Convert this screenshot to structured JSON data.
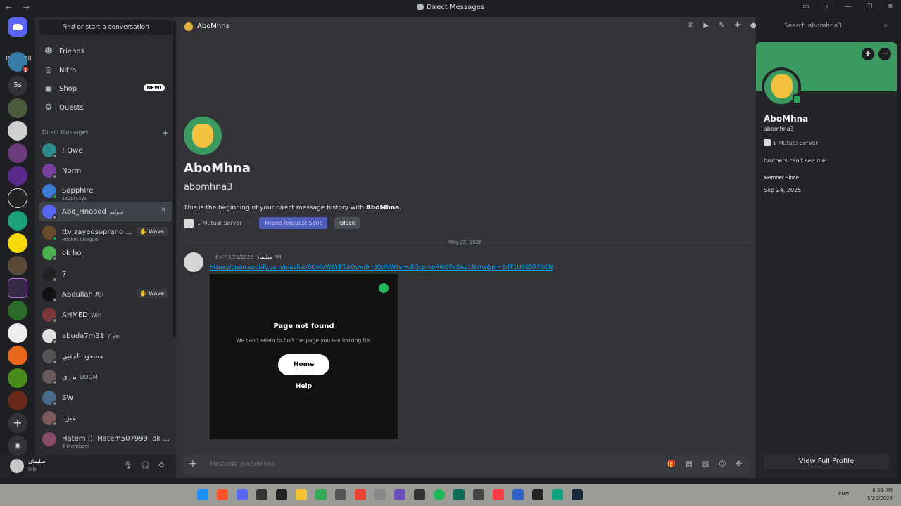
{
  "titlebar": {
    "title": "Direct Messages",
    "nav": "← →"
  },
  "servers": {
    "read_all": "Read All",
    "text_server": "Ss",
    "badge": "1"
  },
  "sidebar": {
    "find_placeholder": "Find or start a conversation",
    "nav": [
      {
        "label": "Friends",
        "icon": "friends-icon"
      },
      {
        "label": "Nitro",
        "icon": "nitro-icon"
      },
      {
        "label": "Shop",
        "icon": "shop-icon",
        "badge": "NEW!"
      },
      {
        "label": "Quests",
        "icon": "quests-icon"
      }
    ],
    "dm_header": "Direct Messages",
    "dms": [
      {
        "name": "! Qwe",
        "color": "#2e8b8b"
      },
      {
        "name": "Norm",
        "color": "#7b3fa0"
      },
      {
        "name": "Sapphire",
        "sub": "sapph.xyz",
        "color": "#3b7bd4"
      },
      {
        "name": "Abo_Hnoood",
        "color": "#5865f2",
        "tag": "سوليم",
        "active": true
      },
      {
        "name": "ttv zayedsoprano ...",
        "sub": "Rocket League",
        "color": "#6b4a2a",
        "wave": "Wave"
      },
      {
        "name": "ok ho",
        "color": "#4caf50"
      },
      {
        "name": "7",
        "color": "#222222"
      },
      {
        "name": "Abdullah Ali",
        "color": "#111111",
        "wave": "Wave"
      },
      {
        "name": "AHMED",
        "color": "#7a3a3a",
        "tag": "Win"
      },
      {
        "name": "abuda7m31",
        "color": "#e0e0e0",
        "tag": "Y ye"
      },
      {
        "name": "مسعود الجنبي",
        "color": "#555555"
      },
      {
        "name": "يزري",
        "color": "#6a5a5a",
        "tag": "DOOM"
      },
      {
        "name": "SW",
        "color": "#4a6a8a"
      },
      {
        "name": "عبرنا",
        "color": "#7a5a5a"
      },
      {
        "name": "Hatem :), Hatem507999, ok ...",
        "sub": "4 Members",
        "color": "#8a4a6a"
      }
    ],
    "wave_label": "Wave"
  },
  "user": {
    "name": "سليمان",
    "status": "Idle"
  },
  "channel": {
    "name": "AboMhna",
    "search_placeholder": "Search abomhna3"
  },
  "intro": {
    "name": "AboMhna",
    "username": "abomhna3",
    "desc_prefix": "This is the beginning of your direct message history with ",
    "desc_name": "AboMhna",
    "desc_suffix": ".",
    "mutual": "1 Mutual Server",
    "friend_request": "Friend Request Sent",
    "block": "Block"
  },
  "messages": {
    "date_divider": "May 25, 2026",
    "author": "سليمان",
    "time": "5/25/2026 6:47 PM",
    "link": "https://open.spotify.com/playlist/6QMVWSYETstOywj9mJQdNW?si=dlOcp-kpR6i67xSAa1Nktw&pi=1dT1U6S5RF2CN",
    "embed": {
      "title": "Page not found",
      "subtitle": "We can't seem to find the page you are looking for.",
      "home": "Home",
      "help": "Help"
    }
  },
  "composer": {
    "placeholder": "Message @AboMhna"
  },
  "profile": {
    "name": "AboMhna",
    "username": "abomhna3",
    "mutual": "1 Mutual Server",
    "bio": "brothers can't see me",
    "member_since_label": "Member Since",
    "member_since": "Sep 24, 2025",
    "view_full": "View Full Profile"
  },
  "taskbar": {
    "lang": "ENG",
    "time": "6:28 AM",
    "date": "5/28/2026"
  },
  "colors": {
    "blurple": "#5865f2",
    "background": "#313338",
    "sidebar": "#2b2d31",
    "link": "#00a8fc",
    "banner": "#3a9a5f"
  }
}
